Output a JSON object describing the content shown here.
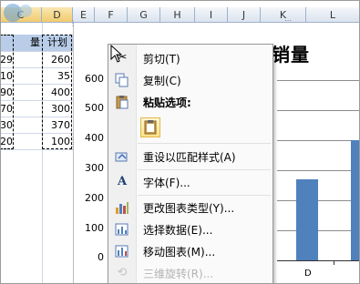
{
  "spreadsheet": {
    "columns": [
      "C",
      "D",
      "E",
      "F",
      "G",
      "H",
      "I",
      "J",
      "K",
      "L"
    ],
    "selected_columns": [
      "C",
      "D"
    ],
    "header_cells": [
      "量",
      "计划"
    ],
    "col_c_values": [
      "29",
      "10",
      "90",
      "70",
      "30",
      "20"
    ],
    "col_d_values": [
      "260",
      "35",
      "400",
      "300",
      "370",
      "100"
    ]
  },
  "chart": {
    "title": "销量",
    "y_ticks": [
      "600",
      "500",
      "400",
      "300",
      "200",
      "100",
      "0"
    ],
    "x_label_visible": "D",
    "bar_color": "#4f81bd"
  },
  "chart_data": {
    "type": "bar",
    "title": "销量",
    "categories": [
      "D",
      ""
    ],
    "values": [
      270,
      400
    ],
    "ylim": [
      0,
      600
    ],
    "xlabel": "",
    "ylabel": ""
  },
  "context_menu": {
    "items": [
      {
        "icon": "scissors-icon",
        "label": "剪切(T)",
        "enabled": true
      },
      {
        "icon": "copy-icon",
        "label": "复制(C)",
        "enabled": true
      },
      {
        "icon": "paste-icon",
        "label": "粘贴选项:",
        "enabled": true,
        "bold": true
      },
      {
        "icon": "reset-style-icon",
        "label": "重设以匹配样式(A)",
        "enabled": true
      },
      {
        "icon": "font-icon",
        "label": "字体(F)...",
        "enabled": true
      },
      {
        "icon": "chart-type-icon",
        "label": "更改图表类型(Y)...",
        "enabled": true
      },
      {
        "icon": "select-data-icon",
        "label": "选择数据(E)...",
        "enabled": true
      },
      {
        "icon": "move-chart-icon",
        "label": "移动图表(M)...",
        "enabled": true
      },
      {
        "icon": "rotate-3d-icon",
        "label": "三维旋转(R)...",
        "enabled": false
      }
    ]
  },
  "colors": {
    "accent_arrow": "#e0202a",
    "header_selected": "#f2cb6e",
    "menu_border": "#979797"
  }
}
